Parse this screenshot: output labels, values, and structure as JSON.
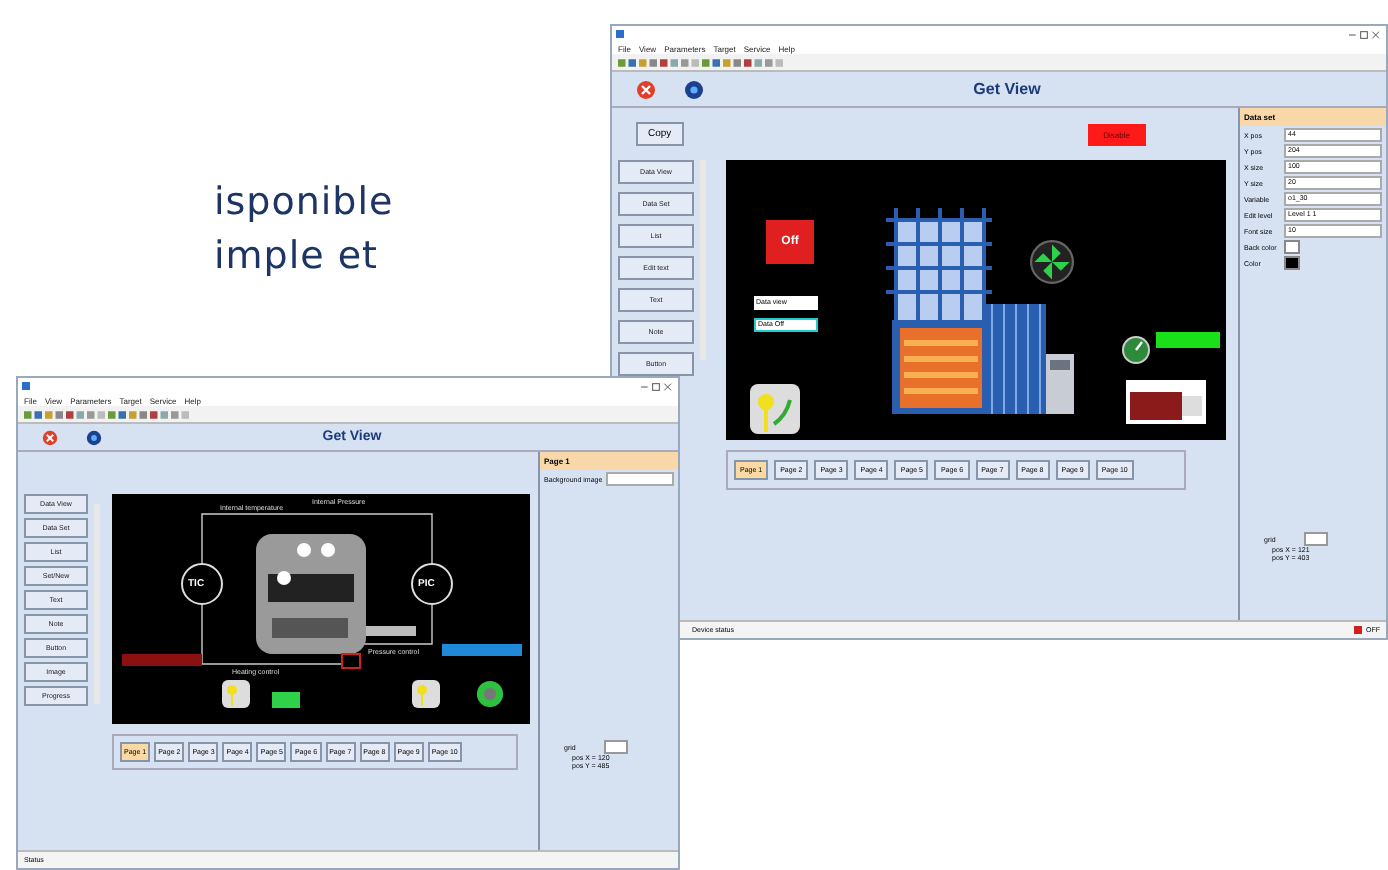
{
  "background_text": [
    "isponible",
    "imple  et"
  ],
  "windows": [
    {
      "menu": [
        "File",
        "View",
        "Parameters",
        "Target",
        "Service",
        "Help"
      ],
      "header": "Get View",
      "copy_button": "Copy",
      "alert_button": "Disable",
      "side_buttons": [
        "Data View",
        "Data Set",
        "List",
        "Edit text",
        "Text",
        "Note",
        "Button"
      ],
      "canvas": {
        "kind": "furnace",
        "off_button": "Off",
        "fields": [
          "Data view",
          "Data Off"
        ]
      },
      "tabs": [
        {
          "label": "Page 1",
          "selected": true
        },
        {
          "label": "Page 2",
          "selected": false
        },
        {
          "label": "Page 3",
          "selected": false
        },
        {
          "label": "Page 4",
          "selected": false
        },
        {
          "label": "Page 5",
          "selected": false
        },
        {
          "label": "Page 6",
          "selected": false
        },
        {
          "label": "Page 7",
          "selected": false
        },
        {
          "label": "Page 8",
          "selected": false
        },
        {
          "label": "Page 9",
          "selected": false
        },
        {
          "label": "Page 10",
          "selected": false
        }
      ],
      "panel": {
        "title": "Data set",
        "fields": [
          {
            "kind": "text",
            "label": "X pos",
            "value": "44"
          },
          {
            "kind": "text",
            "label": "Y pos",
            "value": "204"
          },
          {
            "kind": "text",
            "label": "X size",
            "value": "100"
          },
          {
            "kind": "text",
            "label": "Y size",
            "value": "20"
          },
          {
            "kind": "text",
            "label": "Variable",
            "value": "o1_30"
          },
          {
            "kind": "text",
            "label": "Edit level",
            "value": "Level 1 1"
          },
          {
            "kind": "text",
            "label": "Font size",
            "value": "10"
          },
          {
            "kind": "color",
            "label": "Back color",
            "color": "#ffffff"
          },
          {
            "kind": "color",
            "label": "Color",
            "color": "#000000"
          }
        ]
      },
      "grid": {
        "label": "grid",
        "positions": [
          "pos X = 121",
          "pos Y = 403"
        ]
      },
      "status": {
        "text": "Device status",
        "indicator": "OFF"
      }
    },
    {
      "menu": [
        "File",
        "View",
        "Parameters",
        "Target",
        "Service",
        "Help"
      ],
      "header": "Get View",
      "side_buttons": [
        "Data View",
        "Data Set",
        "List",
        "Set/New",
        "Text",
        "Note",
        "Button",
        "Image",
        "Progress"
      ],
      "canvas": {
        "kind": "process",
        "labels": [
          "Internal temperature",
          "Internal Pressure",
          "Heating control",
          "Pressure control"
        ],
        "tic": "TIC",
        "pic": "PIC"
      },
      "tabs": [
        {
          "label": "Page 1",
          "selected": true
        },
        {
          "label": "Page 2",
          "selected": false
        },
        {
          "label": "Page 3",
          "selected": false
        },
        {
          "label": "Page 4",
          "selected": false
        },
        {
          "label": "Page 5",
          "selected": false
        },
        {
          "label": "Page 6",
          "selected": false
        },
        {
          "label": "Page 7",
          "selected": false
        },
        {
          "label": "Page 8",
          "selected": false
        },
        {
          "label": "Page 9",
          "selected": false
        },
        {
          "label": "Page 10",
          "selected": false
        }
      ],
      "panel": {
        "title": "Page 1",
        "fields": [
          {
            "kind": "text",
            "label": "Background image"
          }
        ]
      },
      "grid": {
        "label": "grid",
        "positions": [
          "pos X = 120",
          "pos Y = 485"
        ]
      },
      "status": {
        "text": "Status"
      }
    }
  ]
}
